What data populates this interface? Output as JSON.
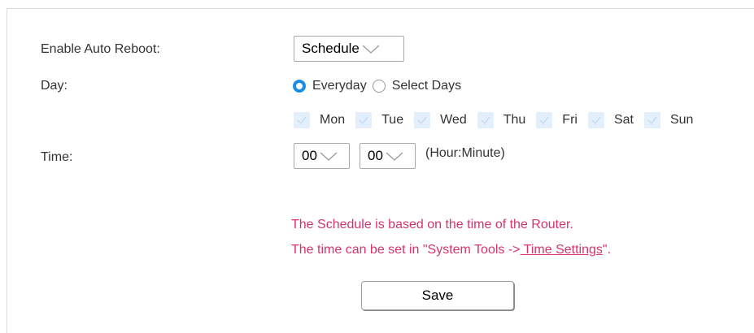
{
  "form": {
    "enable_auto_reboot_label": "Enable Auto Reboot:",
    "enable_auto_reboot_value": "Schedule",
    "day_label": "Day:",
    "radio_everyday": "Everyday",
    "radio_select_days": "Select Days",
    "radio_selected": "Everyday",
    "days": [
      "Mon",
      "Tue",
      "Wed",
      "Thu",
      "Fri",
      "Sat",
      "Sun"
    ],
    "time_label": "Time:",
    "hour_value": "00",
    "minute_value": "00",
    "time_format": "(Hour:Minute)"
  },
  "notice": {
    "line1": "The Schedule is based on the time of the Router.",
    "line2_prefix": "The time can be set in \"System Tools ->",
    "line2_link": " Time Settings",
    "line2_suffix": "\"."
  },
  "actions": {
    "save_label": "Save"
  },
  "colors": {
    "accent_blue": "#1a8ee6",
    "notice_pink": "#d6336c",
    "checkbox_disabled": "#e3effb"
  }
}
